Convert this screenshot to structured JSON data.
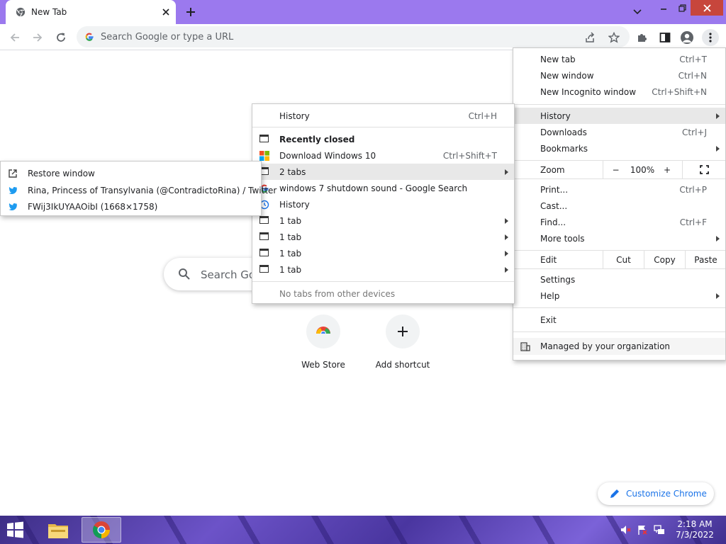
{
  "browser": {
    "tab_title": "New Tab",
    "omnibox_placeholder": "Search Google or type a URL"
  },
  "ntp": {
    "search_placeholder": "Search Google or type a URL",
    "shortcuts": [
      {
        "label": "Web Store"
      },
      {
        "label": "Add shortcut"
      }
    ],
    "customize_label": "Customize Chrome"
  },
  "main_menu": {
    "new_tab": {
      "label": "New tab",
      "shortcut": "Ctrl+T"
    },
    "new_window": {
      "label": "New window",
      "shortcut": "Ctrl+N"
    },
    "incognito": {
      "label": "New Incognito window",
      "shortcut": "Ctrl+Shift+N"
    },
    "history": {
      "label": "History"
    },
    "downloads": {
      "label": "Downloads",
      "shortcut": "Ctrl+J"
    },
    "bookmarks": {
      "label": "Bookmarks"
    },
    "zoom": {
      "label": "Zoom",
      "minus": "−",
      "level": "100%",
      "plus": "+"
    },
    "print": {
      "label": "Print...",
      "shortcut": "Ctrl+P"
    },
    "cast": {
      "label": "Cast..."
    },
    "find": {
      "label": "Find...",
      "shortcut": "Ctrl+F"
    },
    "more_tools": {
      "label": "More tools"
    },
    "edit": {
      "label": "Edit",
      "cut": "Cut",
      "copy": "Copy",
      "paste": "Paste"
    },
    "settings": {
      "label": "Settings"
    },
    "help": {
      "label": "Help"
    },
    "exit": {
      "label": "Exit"
    },
    "managed": {
      "label": "Managed by your organization"
    }
  },
  "history_menu": {
    "history": {
      "label": "History",
      "shortcut": "Ctrl+H"
    },
    "recently_closed": "Recently closed",
    "items": [
      {
        "label": "Download Windows 10",
        "shortcut": "Ctrl+Shift+T"
      },
      {
        "label": "2 tabs"
      },
      {
        "label": "windows 7 shutdown sound - Google Search"
      },
      {
        "label": "History"
      },
      {
        "label": "1 tab"
      },
      {
        "label": "1 tab"
      },
      {
        "label": "1 tab"
      },
      {
        "label": "1 tab"
      }
    ],
    "no_tabs": "No tabs from other devices"
  },
  "tabs_menu": {
    "items": [
      {
        "label": "Restore window"
      },
      {
        "label": "Rina, Princess of Transylvania (@ContradictoRina) / Twitter"
      },
      {
        "label": "FWij3IkUYAAOibI (1668×1758)"
      }
    ]
  },
  "taskbar": {
    "time": "2:18 AM",
    "date": "7/3/2022"
  },
  "colors": {
    "titlebar": "#9b79ee",
    "close_button": "#c7463c",
    "accent_blue": "#1a73e8",
    "menu_highlight": "#e8e8e8"
  },
  "icons": {
    "tab_favicon": "chrome-favicon-icon",
    "back": "back-arrow-icon",
    "forward": "forward-arrow-icon",
    "reload": "reload-icon",
    "share": "share-icon",
    "star": "star-icon",
    "extensions": "puzzle-icon",
    "side_panel": "side-panel-icon",
    "profile": "avatar-icon",
    "menu": "kebab-menu-icon"
  }
}
